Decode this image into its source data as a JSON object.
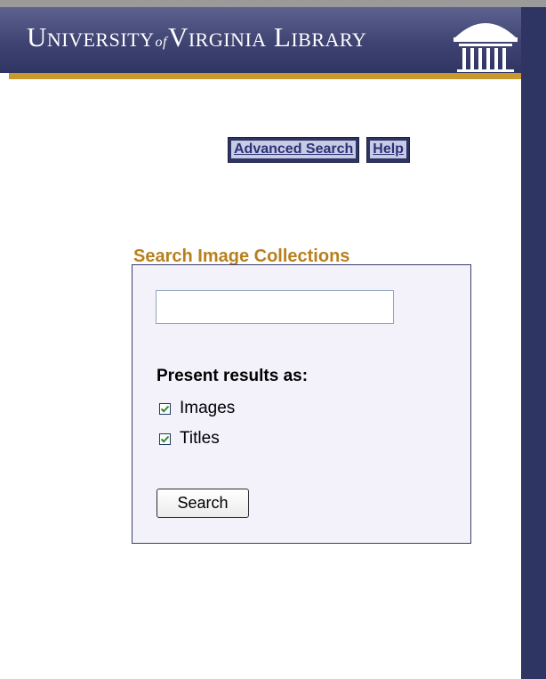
{
  "header": {
    "logo": {
      "u": "U",
      "niversity": "NIVERSITY",
      "of": "of",
      "v": "V",
      "irginia": "IRGINIA",
      "l": "L",
      "ibrary": "IBRARY"
    }
  },
  "nav": {
    "advanced_search": "Advanced Search",
    "help": "Help"
  },
  "search_box": {
    "title": "Search Image Collections",
    "query_value": "",
    "present_label": "Present results as:",
    "options": [
      {
        "label": "Images",
        "checked": true
      },
      {
        "label": "Titles",
        "checked": true
      }
    ],
    "search_button": "Search"
  },
  "colors": {
    "header_navy": "#3f4372",
    "gold": "#c9992e",
    "title_gold": "#b8801c",
    "box_background": "#f3f2fb",
    "check_green": "#2f8a2f"
  }
}
